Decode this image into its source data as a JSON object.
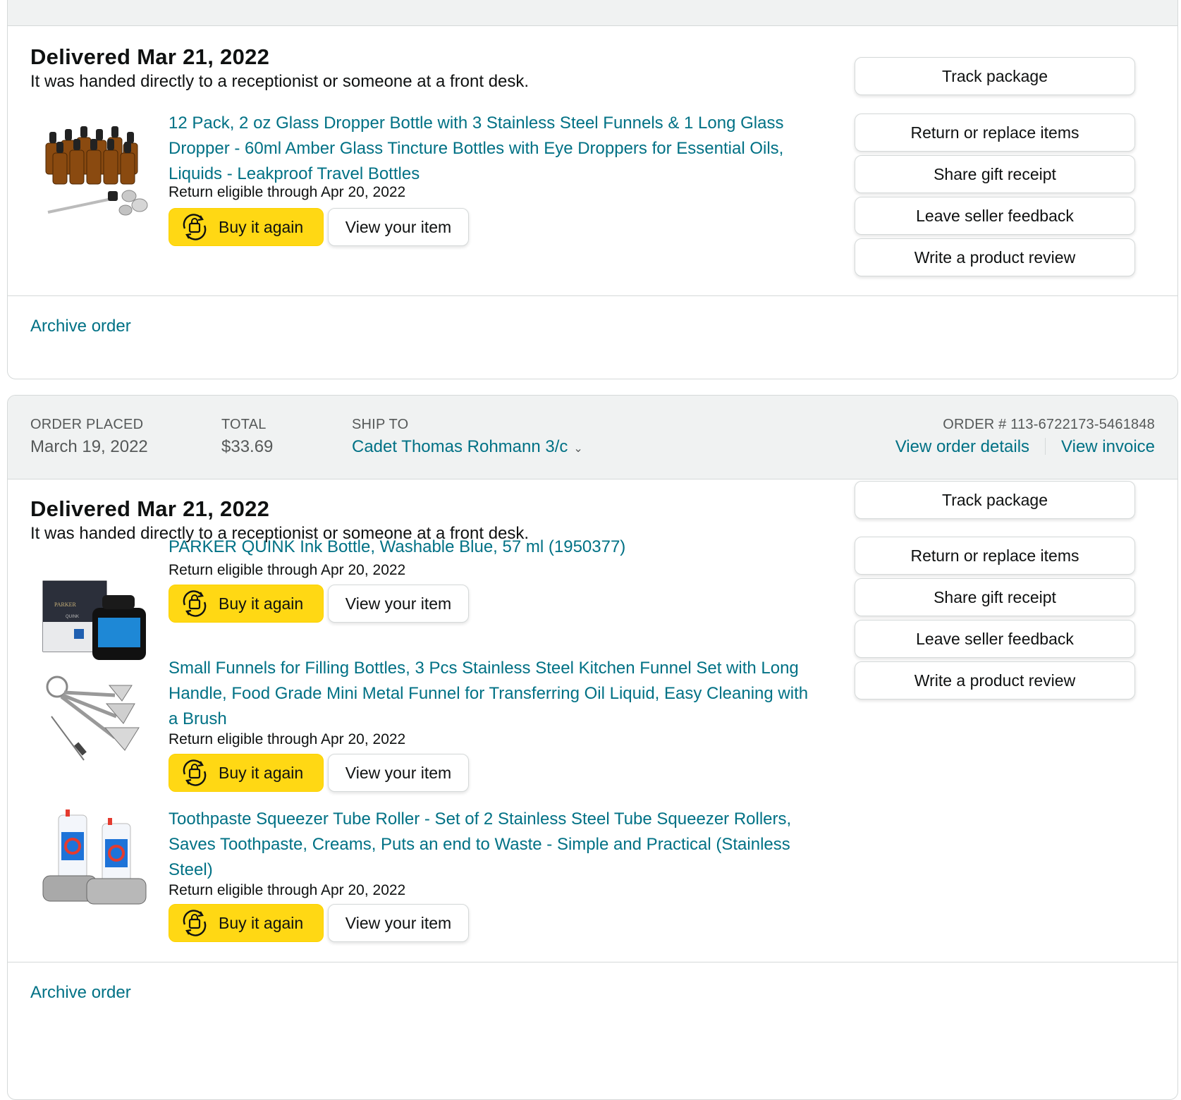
{
  "order1": {
    "delivery_status": "Delivered Mar 21, 2022",
    "delivery_note": "It was handed directly to a receptionist or someone at a front desk.",
    "items": [
      {
        "title": "12 Pack, 2 oz Glass Dropper Bottle with 3 Stainless Steel Funnels & 1 Long Glass Dropper - 60ml Amber Glass Tincture Bottles with Eye Droppers for Essential Oils, Liquids - Leakproof Travel Bottles",
        "return_text": "Return eligible through Apr 20, 2022",
        "buy_label": "Buy it again",
        "view_label": "View your item"
      }
    ],
    "actions": [
      "Track package",
      "Return or replace items",
      "Share gift receipt",
      "Leave seller feedback",
      "Write a product review"
    ],
    "archive_label": "Archive order"
  },
  "order2": {
    "header": {
      "placed_label": "ORDER PLACED",
      "placed_value": "March 19, 2022",
      "total_label": "TOTAL",
      "total_value": "$33.69",
      "ship_label": "SHIP TO",
      "ship_value": "Cadet Thomas Rohmann 3/c",
      "order_number": "ORDER # 113-6722173-5461848",
      "details_link": "View order details",
      "invoice_link": "View invoice"
    },
    "delivery_status": "Delivered Mar 21, 2022",
    "delivery_note": "It was handed directly to a receptionist or someone at a front desk.",
    "items": [
      {
        "title": "PARKER QUINK Ink Bottle, Washable Blue, 57 ml (1950377)",
        "return_text": "Return eligible through Apr 20, 2022",
        "buy_label": "Buy it again",
        "view_label": "View your item",
        "box_brand": "PARKER",
        "box_sub": "QUINK"
      },
      {
        "title": "Small Funnels for Filling Bottles, 3 Pcs Stainless Steel Kitchen Funnel Set with Long Handle, Food Grade Mini Metal Funnel for Transferring Oil Liquid, Easy Cleaning with a Brush",
        "return_text": "Return eligible through Apr 20, 2022",
        "buy_label": "Buy it again",
        "view_label": "View your item"
      },
      {
        "title": "Toothpaste Squeezer Tube Roller  - Set of 2  Stainless Steel Tube Squeezer Rollers, Saves Toothpaste, Creams, Puts an end to Waste - Simple and Practical (Stainless Steel)",
        "return_text": "Return eligible through Apr 20, 2022",
        "buy_label": "Buy it again",
        "view_label": "View your item"
      }
    ],
    "actions": [
      "Track package",
      "Return or replace items",
      "Share gift receipt",
      "Leave seller feedback",
      "Write a product review"
    ],
    "archive_label": "Archive order"
  },
  "colors": {
    "link": "#007185",
    "buy_button": "#ffd814",
    "header_bg": "#f0f2f2",
    "border": "#d5d9d9"
  },
  "icons": {
    "buy_again": "buy-again-icon",
    "ship_to_dropdown": "chevron-down-icon"
  }
}
